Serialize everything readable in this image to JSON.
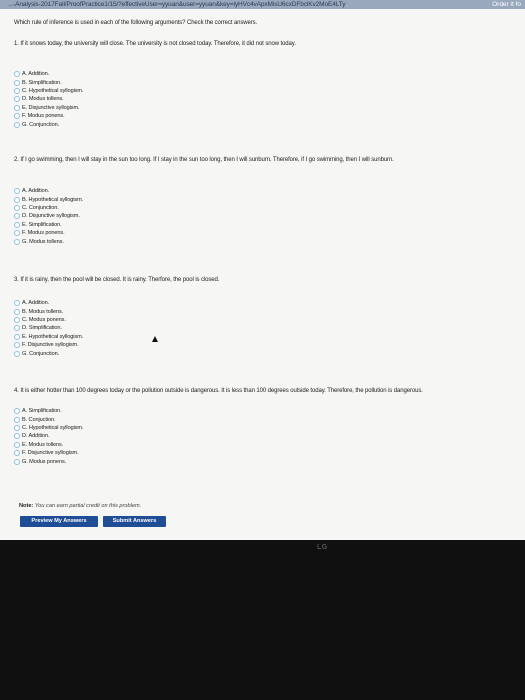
{
  "browser": {
    "url_text": "...-Analysis-2017Fall/ProofPractice1/15/?effectiveUser=yyuan&user=yyuan&key=lyHVc4vApxMisU6cxDFbclKv2MoE4LTy",
    "right_text": "Order it fo"
  },
  "page": {
    "instructions": "Which rule of inference is used in each of the following arguments? Check the correct answers.",
    "questions": [
      {
        "text": "1. If it snows today, the university will close. The university is not closed today. Therefore, it did not snow today.",
        "options": [
          "A. Addition.",
          "B. Simplification.",
          "C. Hypothetical syllogism.",
          "D. Modus tollens.",
          "E. Disjunctive syllogism.",
          "F. Modus ponens.",
          "G. Conjunction."
        ]
      },
      {
        "text": "2. If I go swimming, then I will stay in the sun too long. If I stay in the sun too long, then I will sunburn. Therefore, if I go swimming, then I will sunburn.",
        "options": [
          "A. Addition.",
          "B. Hypothetical syllogism.",
          "C. Conjunction.",
          "D. Disjunctive syllogism.",
          "E. Simplification.",
          "F. Modus ponens.",
          "G. Modus tollens."
        ]
      },
      {
        "text": "3. If it is rainy, then the pool will be closed. It is rainy. Therfore, the pool is closed.",
        "options": [
          "A. Addition.",
          "B. Modus tollens.",
          "C. Modus ponens.",
          "D. Simplification.",
          "E. Hypothetical syllogism.",
          "F. Disjunctive syllogism.",
          "G. Conjunction."
        ]
      },
      {
        "text": "4. It is either hotter than 100 degrees today or the pollution outside is dangerous. It is less than 100 degrees outside today. Therefore, the pollution is dangerous.",
        "options": [
          "A. Simplification.",
          "B. Conjuction.",
          "C. Hypothetical syllogism.",
          "D. Addition.",
          "E. Modus tollens.",
          "F. Disjunctive syllogism.",
          "G. Modus ponens."
        ]
      }
    ],
    "note_label": "Note:",
    "note_text": "You can earn partial credit on this problem.",
    "preview_button": "Preview My Answers",
    "submit_button": "Submit Answers"
  },
  "monitor": {
    "brand": "LG"
  }
}
